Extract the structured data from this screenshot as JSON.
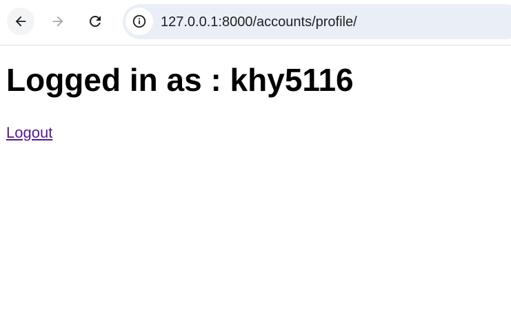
{
  "browser": {
    "url": "127.0.0.1:8000/accounts/profile/",
    "icons": {
      "back": "back-arrow-icon",
      "forward": "forward-arrow-icon",
      "reload": "reload-icon",
      "site_info": "info-icon"
    }
  },
  "page": {
    "heading": "Logged in as : khy5116",
    "logout_label": "Logout"
  },
  "colors": {
    "visited_link": "#551a8b",
    "omnibox_bg": "#eaeef7"
  }
}
